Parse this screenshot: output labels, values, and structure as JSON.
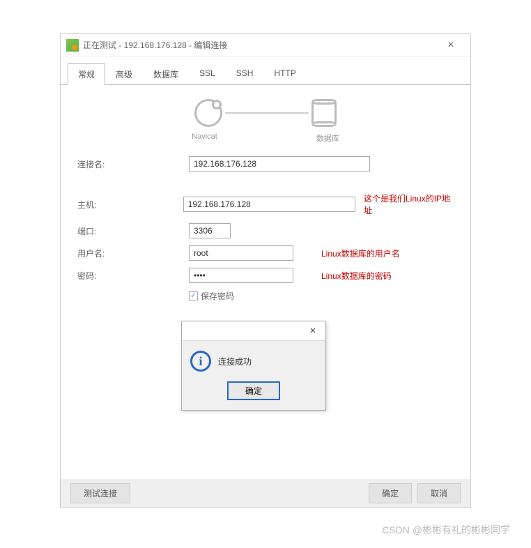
{
  "window": {
    "title": "正在测试 - 192.168.176.128 - 编辑连接"
  },
  "tabs": {
    "t0": "常规",
    "t1": "高级",
    "t2": "数据库",
    "t3": "SSL",
    "t4": "SSH",
    "t5": "HTTP"
  },
  "header": {
    "navicat": "Navicat",
    "db": "数据库"
  },
  "form": {
    "conn_label": "连接名:",
    "conn_value": "192.168.176.128",
    "host_label": "主机:",
    "host_value": "192.168.176.128",
    "host_note": "这个是我们Linux的IP地址",
    "port_label": "端口:",
    "port_value": "3306",
    "user_label": "用户名:",
    "user_value": "root",
    "user_note": "Linux数据库的用户名",
    "pass_label": "密码:",
    "pass_value": "••••",
    "pass_note": "Linux数据库的密码",
    "save_pass": "保存密码"
  },
  "dialog": {
    "message": "连接成功",
    "ok": "确定"
  },
  "bottom": {
    "test": "测试连接",
    "ok": "确定",
    "cancel": "取消"
  },
  "watermark": "CSDN @彬彬有礼的彬彬同学"
}
